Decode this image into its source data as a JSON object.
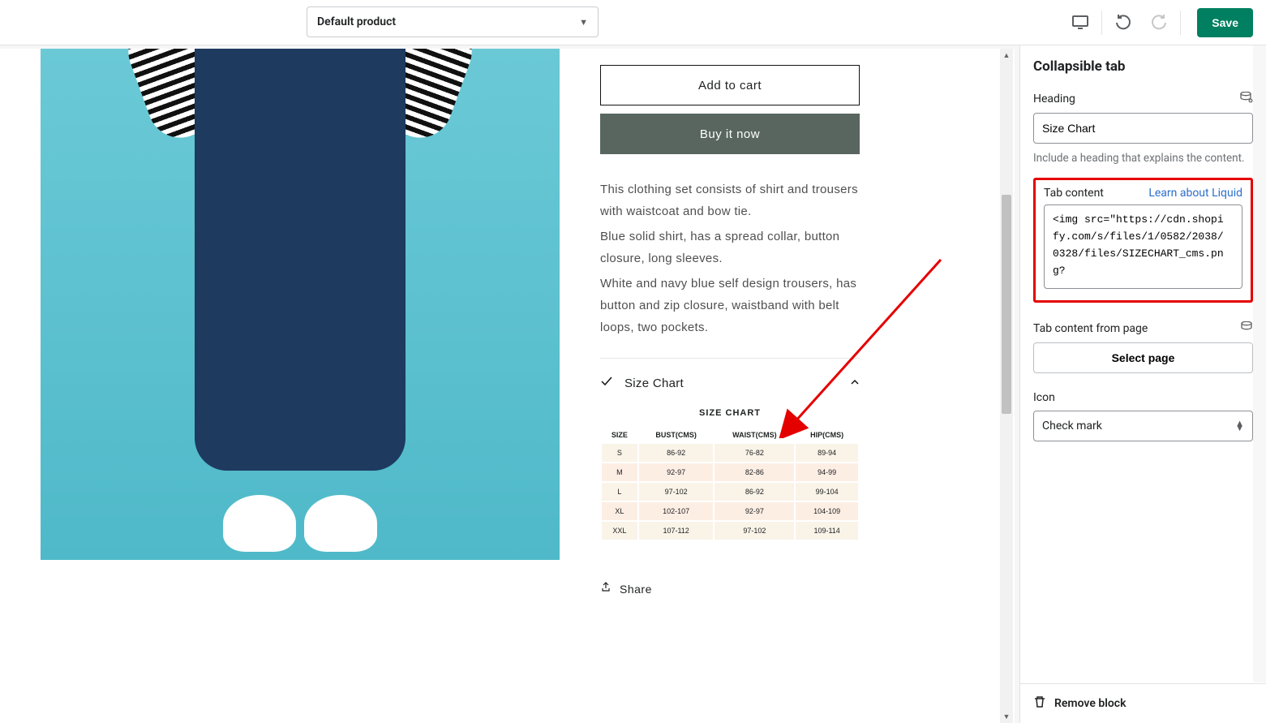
{
  "topbar": {
    "product_select": "Default product",
    "save": "Save"
  },
  "preview": {
    "add_to_cart": "Add to cart",
    "buy_now": "Buy it now",
    "desc_line1": "This clothing set consists of shirt and trousers with waistcoat and bow tie.",
    "desc_line2": "Blue solid shirt, has a spread collar, button closure, long sleeves.",
    "desc_line3": "White and navy blue self design trousers, has button and zip closure, waistband with belt loops, two pockets.",
    "size_chart_label": "Size Chart",
    "sizechart_title": "SIZE CHART",
    "sizechart_headers": [
      "SIZE",
      "BUST(CMS)",
      "WAIST(CMS)",
      "HIP(CMS)"
    ],
    "sizechart_rows": [
      {
        "size": "S",
        "bust": "86-92",
        "waist": "76-82",
        "hip": "89-94"
      },
      {
        "size": "M",
        "bust": "92-97",
        "waist": "82-86",
        "hip": "94-99"
      },
      {
        "size": "L",
        "bust": "97-102",
        "waist": "86-92",
        "hip": "99-104"
      },
      {
        "size": "XL",
        "bust": "102-107",
        "waist": "92-97",
        "hip": "104-109"
      },
      {
        "size": "XXL",
        "bust": "107-112",
        "waist": "97-102",
        "hip": "109-114"
      }
    ],
    "share": "Share"
  },
  "sidebar": {
    "title": "Collapsible tab",
    "heading_label": "Heading",
    "heading_value": "Size Chart",
    "heading_help": "Include a heading that explains the content.",
    "tab_content_label": "Tab content",
    "liquid_link": "Learn about Liquid",
    "tab_content_value": "<img src=\"https://cdn.shopify.com/s/files/1/0582/2038/0328/files/SIZECHART_cms.png?",
    "tab_content_page_label": "Tab content from page",
    "select_page": "Select page",
    "icon_label": "Icon",
    "icon_value": "Check mark",
    "remove_block": "Remove block"
  }
}
